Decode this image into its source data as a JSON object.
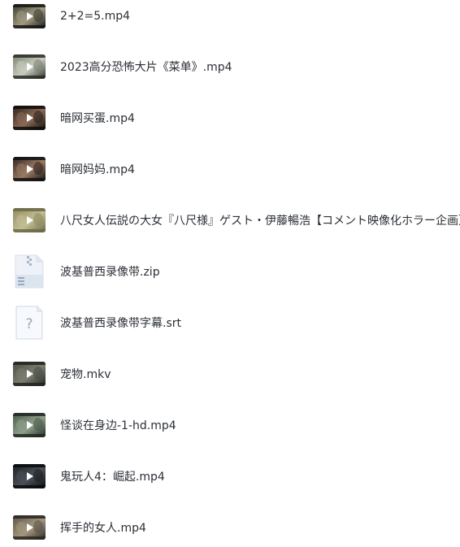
{
  "files": [
    {
      "name": "2+2=5.mp4",
      "type": "video",
      "thumb_colors": [
        "#3c3a30",
        "#a09a80",
        "#151515"
      ]
    },
    {
      "name": "2023高分恐怖大片《菜单》.mp4",
      "type": "video",
      "thumb_colors": [
        "#7c8470",
        "#c9ccc0",
        "#2a2c26"
      ]
    },
    {
      "name": "暗网买蛋.mp4",
      "type": "video",
      "thumb_colors": [
        "#2a1f1b",
        "#8b6a55",
        "#0e0c0b"
      ]
    },
    {
      "name": "暗网妈妈.mp4",
      "type": "video",
      "thumb_colors": [
        "#2d2320",
        "#9a7a62",
        "#111010"
      ]
    },
    {
      "name": "八尺女人伝説の大女『八尺様』ゲスト・伊藤暢浩【コメント映像化ホラー企画】",
      "type": "video",
      "thumb_colors": [
        "#8e8a62",
        "#c3bd92",
        "#6a6a48"
      ]
    },
    {
      "name": "波基普西录像带.zip",
      "type": "zip",
      "icon": "zip-file-icon"
    },
    {
      "name": "波基普西录像带字幕.srt",
      "type": "unknown",
      "icon": "unknown-file-icon"
    },
    {
      "name": "宠物.mkv",
      "type": "video",
      "thumb_colors": [
        "#4a4d45",
        "#7b7e70",
        "#22241f"
      ]
    },
    {
      "name": "怪谈在身边-1-hd.mp4",
      "type": "video",
      "thumb_colors": [
        "#4b5a4c",
        "#8fa08a",
        "#202822"
      ]
    },
    {
      "name": "鬼玩人4：崛起.mp4",
      "type": "video",
      "thumb_colors": [
        "#1b1f22",
        "#4a5058",
        "#0a0b0c"
      ]
    },
    {
      "name": "挥手的女人.mp4",
      "type": "video",
      "thumb_colors": [
        "#5a5347",
        "#a4977f",
        "#2a2620"
      ]
    }
  ]
}
